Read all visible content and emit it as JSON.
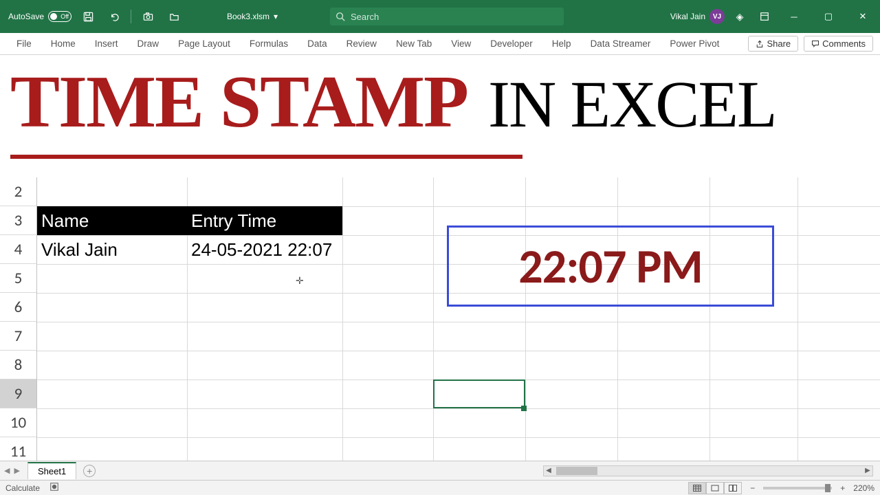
{
  "titlebar": {
    "autosave_label": "AutoSave",
    "autosave_state": "Off",
    "filename": "Book3.xlsm",
    "search_placeholder": "Search",
    "user_name": "Vikal Jain",
    "user_initials": "VJ"
  },
  "ribbon": {
    "tabs": [
      "File",
      "Home",
      "Insert",
      "Draw",
      "Page Layout",
      "Formulas",
      "Data",
      "Review",
      "New Tab",
      "View",
      "Developer",
      "Help",
      "Data Streamer",
      "Power Pivot"
    ],
    "share": "Share",
    "comments": "Comments"
  },
  "title_art": {
    "red": "TIME STAMP",
    "black": "IN EXCEL"
  },
  "table": {
    "h1": "Name",
    "h2": "Entry Time",
    "r1c1": "Vikal Jain",
    "r1c2": "24-05-2021 22:07"
  },
  "clock": "22:07 PM",
  "row_numbers": [
    "2",
    "3",
    "4",
    "5",
    "6",
    "7",
    "8",
    "9",
    "10",
    "11"
  ],
  "sheet": {
    "name": "Sheet1"
  },
  "status": {
    "left": "Calculate",
    "zoom": "220%"
  }
}
